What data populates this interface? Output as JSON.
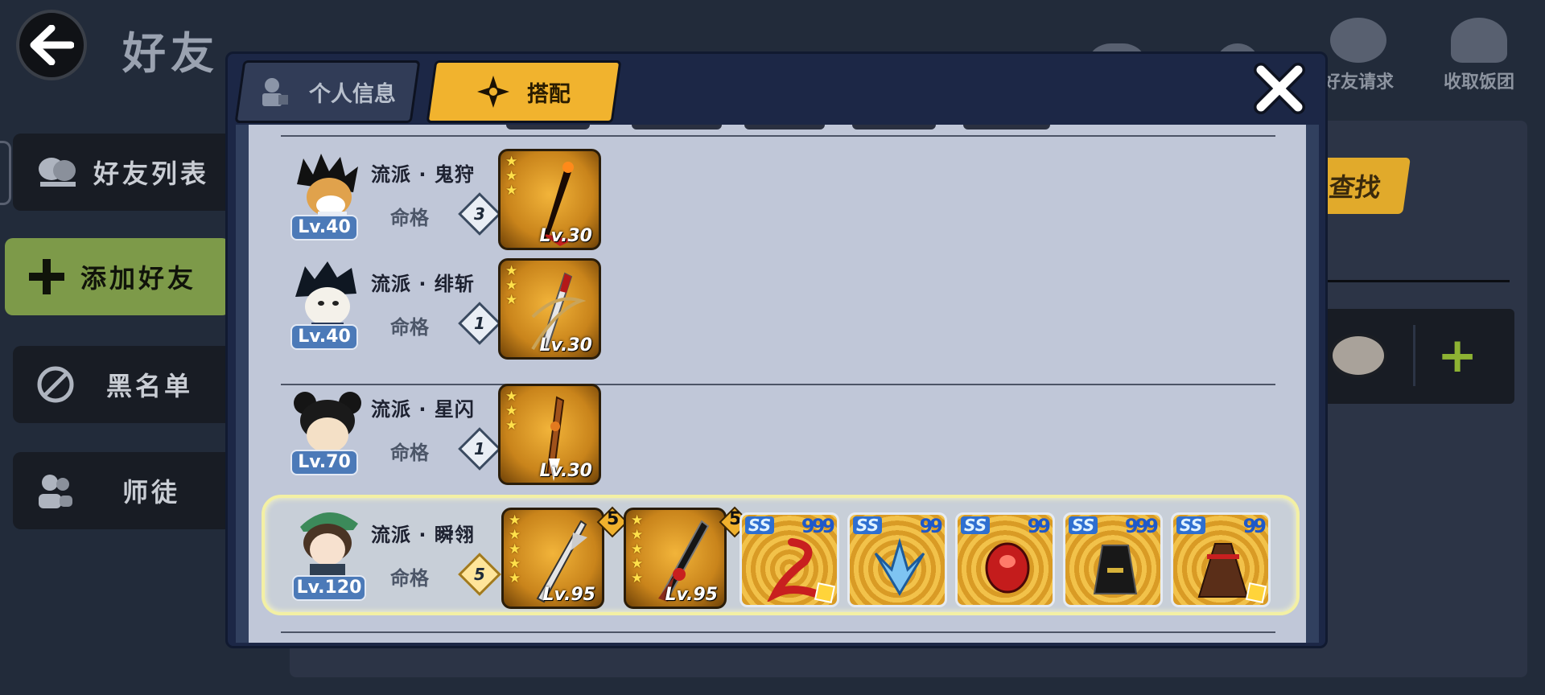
{
  "page": {
    "title": "好友"
  },
  "sidebar": {
    "items": [
      {
        "label": "好友列表",
        "icon": "friends-icon",
        "active": false
      },
      {
        "label": "添加好友",
        "icon": "plus-icon",
        "active": true
      },
      {
        "label": "黑名单",
        "icon": "ban-icon",
        "active": false
      },
      {
        "label": "师徒",
        "icon": "mentor-icon",
        "active": false
      }
    ]
  },
  "top_icons": [
    {
      "label": "",
      "icon": "chat-bubbles-icon"
    },
    {
      "label": "",
      "icon": "people-icon"
    },
    {
      "label": "好友请求",
      "icon": "soap-icon"
    },
    {
      "label": "收取饭团",
      "icon": "rice-ball-icon"
    }
  ],
  "background_panel": {
    "search_label": "查找"
  },
  "modal": {
    "tabs": [
      {
        "label": "个人信息",
        "active": false
      },
      {
        "label": "搭配",
        "active": true
      }
    ],
    "fate_label": "命格",
    "rows": [
      {
        "level": "Lv.40",
        "school": "流派 · 鬼狩",
        "fate": "3",
        "weapons": [
          {
            "stars": 3,
            "level": "Lv.30"
          }
        ],
        "gems": []
      },
      {
        "level": "Lv.40",
        "school": "流派 · 绯斩",
        "fate": "1",
        "weapons": [
          {
            "stars": 3,
            "level": "Lv.30"
          }
        ],
        "gems": []
      },
      {
        "level": "Lv.70",
        "school": "流派 · 星闪",
        "fate": "1",
        "weapons": [
          {
            "stars": 3,
            "level": "Lv.30"
          }
        ],
        "gems": []
      },
      {
        "level": "Lv.120",
        "school": "流派 · 瞬翎",
        "fate": "5",
        "weapons": [
          {
            "stars": 5,
            "level": "Lv.95",
            "rank": "5"
          },
          {
            "stars": 5,
            "level": "Lv.95",
            "rank": "5"
          }
        ],
        "gems": [
          {
            "grade": "SS",
            "nines": "999"
          },
          {
            "grade": "SS",
            "nines": "99"
          },
          {
            "grade": "SS",
            "nines": "99"
          },
          {
            "grade": "SS",
            "nines": "999"
          },
          {
            "grade": "SS",
            "nines": "99"
          }
        ]
      }
    ]
  }
}
